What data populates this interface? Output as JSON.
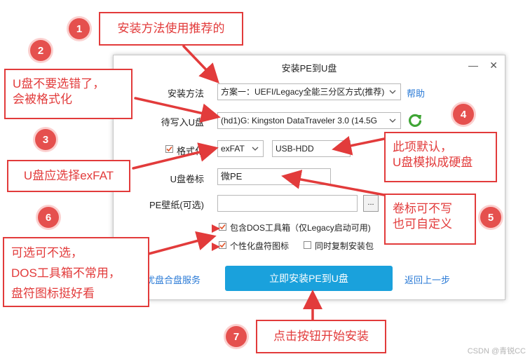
{
  "dialog": {
    "title": "安装PE到U盘",
    "minimize_glyph": "—",
    "close_glyph": "✕",
    "method_label": "安装方法",
    "method_value": "方案一：UEFI/Legacy全能三分区方式(推荐)",
    "help_link": "帮助",
    "target_label": "待写入U盘",
    "target_value": "(hd1)G: Kingston DataTraveler 3.0 (14.5G",
    "format_label": "格式化",
    "format_checked": true,
    "fs_value": "exFAT",
    "mode_value": "USB-HDD",
    "volume_label": "U盘卷标",
    "volume_value": "微PE",
    "wallpaper_label": "PE壁纸(可选)",
    "wallpaper_value": "",
    "browse_label": "...",
    "dos_option": "包含DOS工具箱（仅Legacy启动可用)",
    "icon_option": "个性化盘符图标",
    "copy_option": "同时复制安装包",
    "service_link": "优盘合盘服务",
    "install_button": "立即安装PE到U盘",
    "back_link": "返回上一步"
  },
  "callouts": {
    "c1": {
      "number": "1",
      "text": "安装方法使用推荐的"
    },
    "c2": {
      "number": "2",
      "line1": "U盘不要选错了，",
      "line2": "会被格式化"
    },
    "c3": {
      "number": "3",
      "text": "U盘应选择exFAT"
    },
    "c4": {
      "number": "4",
      "line1": "此项默认，",
      "line2": "U盘模拟成硬盘"
    },
    "c5": {
      "number": "5",
      "line1": "卷标可不写",
      "line2": "也可自定义"
    },
    "c6": {
      "number": "6",
      "line1": "可选可不选，",
      "line2": "DOS工具箱不常用，",
      "line3": "盘符图标挺好看"
    },
    "c7": {
      "number": "7",
      "text": "点击按钮开始安装"
    }
  },
  "colors": {
    "accent": "#e23b3b",
    "button": "#1aa1dc",
    "link": "#2a7ad6"
  },
  "watermark": "CSDN @青锐CC"
}
